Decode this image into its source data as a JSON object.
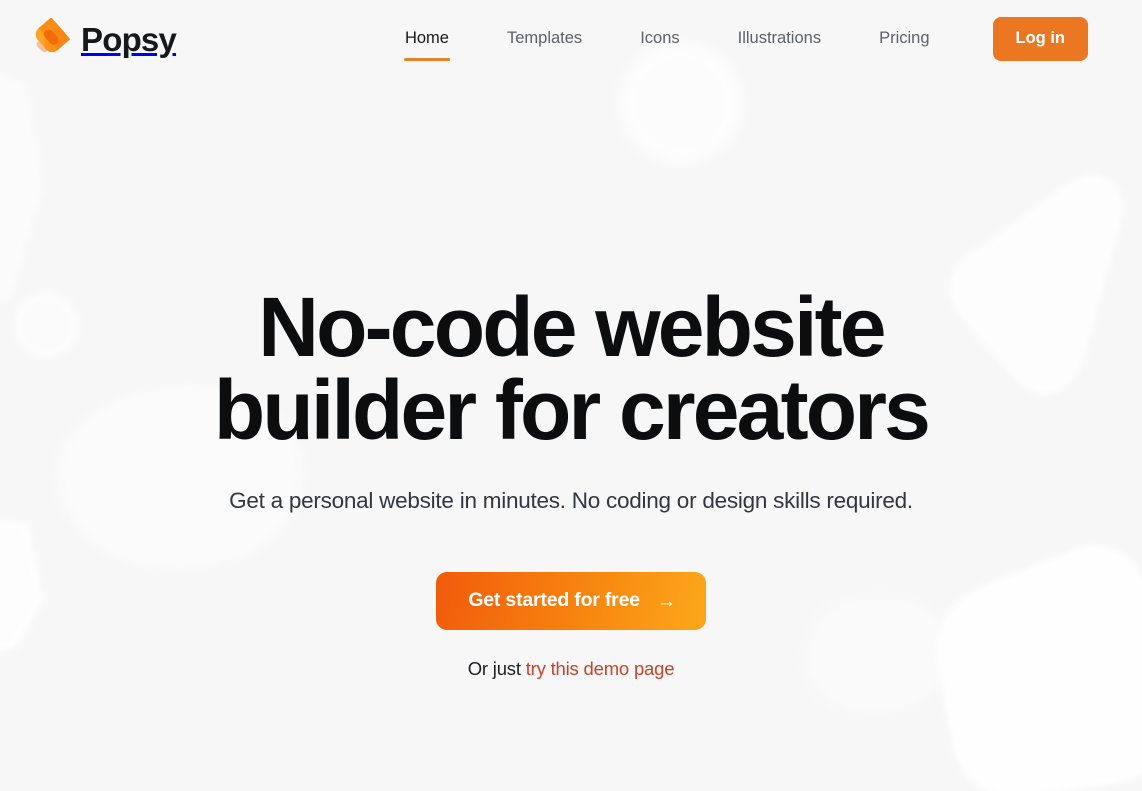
{
  "brand": {
    "name": "Popsy",
    "logo_icon": "popsicle-icon",
    "logo_colors": {
      "body_light": "#ffa426",
      "body_mid": "#fb8c14",
      "body_dark": "#f36c0a",
      "stick": "#f2c3a0"
    }
  },
  "nav": {
    "items": [
      {
        "label": "Home",
        "active": true
      },
      {
        "label": "Templates",
        "active": false
      },
      {
        "label": "Icons",
        "active": false
      },
      {
        "label": "Illustrations",
        "active": false
      },
      {
        "label": "Pricing",
        "active": false
      }
    ],
    "login_label": "Log in"
  },
  "hero": {
    "title_line_1": "No-code website",
    "title_line_2": "builder for creators",
    "subtitle": "Get a personal website in minutes. No coding or design skills required.",
    "cta_label": "Get started for free",
    "cta_arrow": "→",
    "demo_prefix": "Or just ",
    "demo_link_label": "try this demo page"
  },
  "colors": {
    "background": "#f7f7f7",
    "accent_orange": "#ec7722",
    "cta_gradient_start": "#f15b0b",
    "cta_gradient_end": "#fca81a",
    "link_red": "#c7432a",
    "heading": "#0c0d0e",
    "nav_inactive": "#5d6169",
    "decor_white": "#ffffff"
  }
}
